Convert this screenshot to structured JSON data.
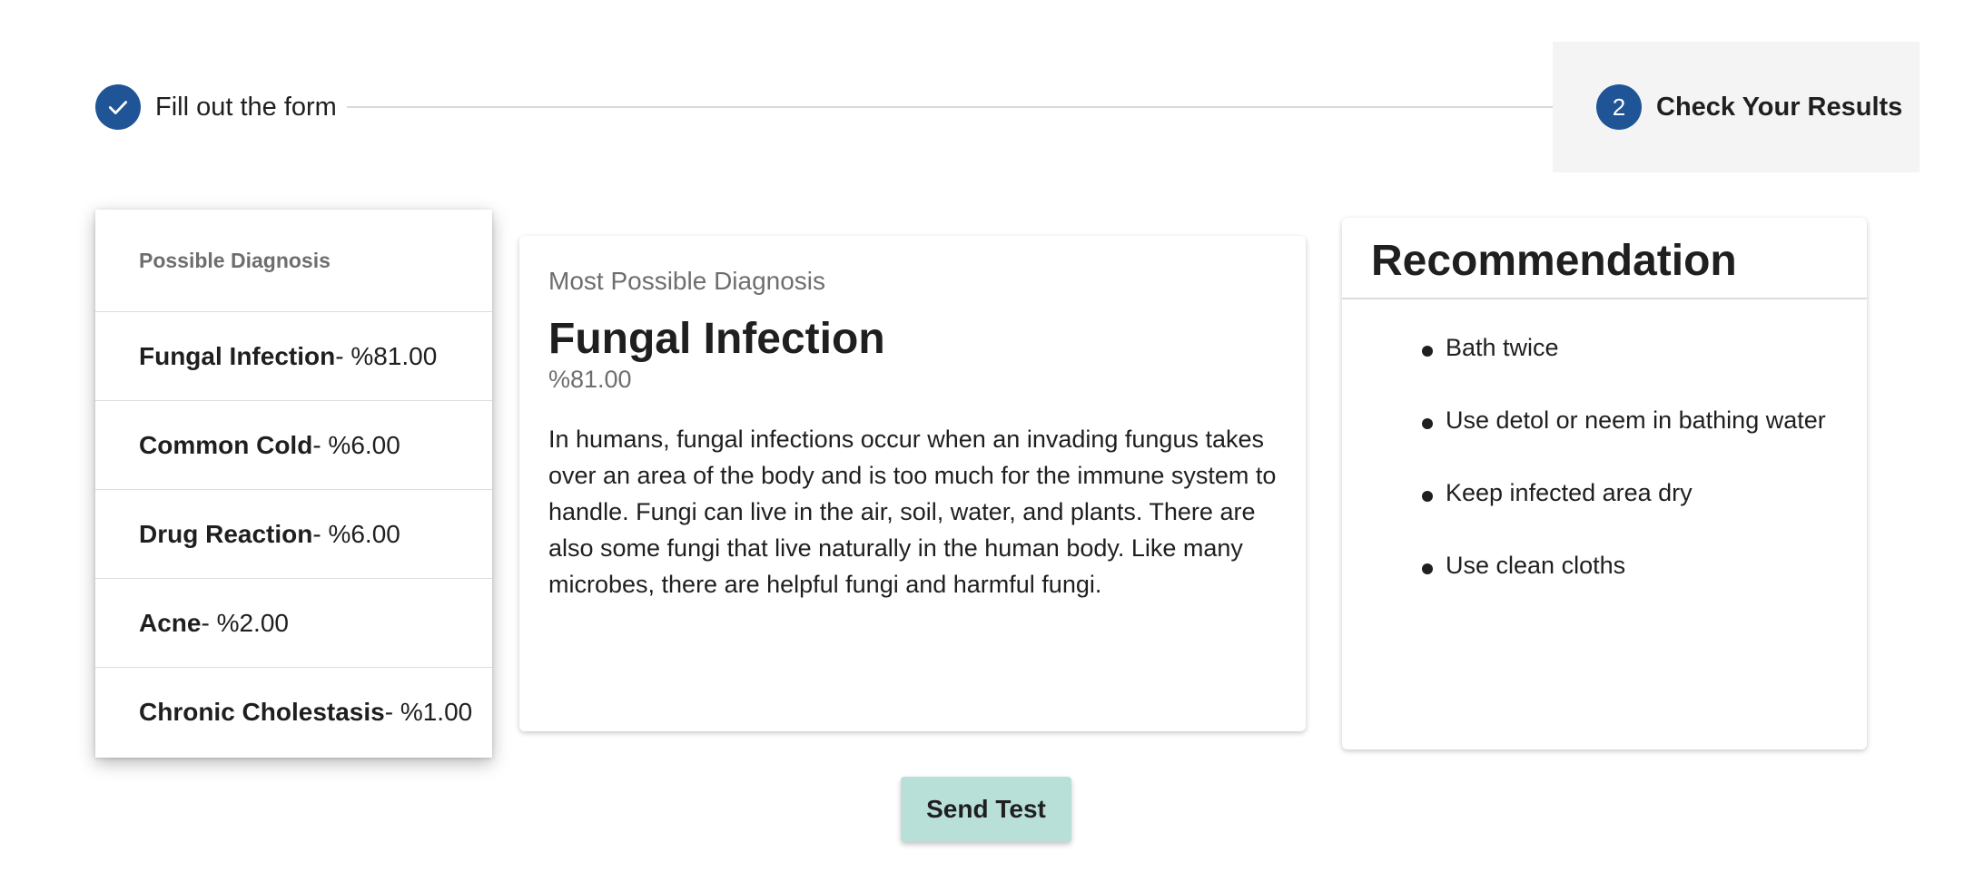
{
  "stepper": {
    "steps": [
      {
        "label": "Fill out the form",
        "status": "completed",
        "icon": "check-icon"
      },
      {
        "label": "Check Your Results",
        "number": "2",
        "status": "active"
      }
    ]
  },
  "possible_diagnosis": {
    "header": "Possible Diagnosis",
    "items": [
      {
        "name": "Fungal Infection",
        "percent": "- %81.00"
      },
      {
        "name": "Common Cold",
        "percent": "- %6.00"
      },
      {
        "name": "Drug Reaction",
        "percent": "- %6.00"
      },
      {
        "name": "Acne",
        "percent": "- %2.00"
      },
      {
        "name": "Chronic Cholestasis",
        "percent": "- %1.00"
      }
    ]
  },
  "main_diagnosis": {
    "overline": "Most Possible Diagnosis",
    "title": "Fungal Infection",
    "percent": "%81.00",
    "description": "In humans, fungal infections occur when an invading fungus takes over an area of the body and is too much for the immune system to handle. Fungi can live in the air, soil, water, and plants. There are also some fungi that live naturally in the human body. Like many microbes, there are helpful fungi and harmful fungi."
  },
  "recommendation": {
    "title": "Recommendation",
    "items": [
      "Bath twice",
      "Use detol or neem in bathing water",
      "Keep infected area dry",
      "Use clean cloths"
    ]
  },
  "actions": {
    "send_label": "Send Test"
  },
  "colors": {
    "primary": "#1f5596",
    "button_bg": "#b9dfd9",
    "active_step_bg": "#f4f4f4"
  }
}
